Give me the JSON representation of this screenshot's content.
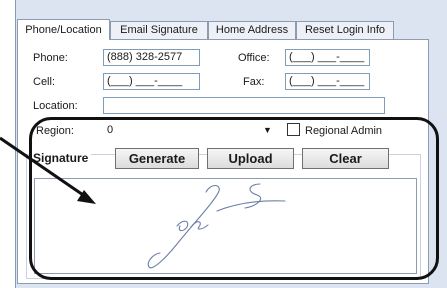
{
  "tabs": [
    {
      "label": "Phone/Location",
      "active": true
    },
    {
      "label": "Email Signature",
      "active": false
    },
    {
      "label": "Home Address",
      "active": false
    },
    {
      "label": "Reset Login Info",
      "active": false
    }
  ],
  "form": {
    "phone_label": "Phone:",
    "phone_value": "(888) 328-2577",
    "office_label": "Office:",
    "office_value": "(___) ___-____",
    "cell_label": "Cell:",
    "cell_value": "(___) ___-____",
    "fax_label": "Fax:",
    "fax_value": "(___) ___-____",
    "location_label": "Location:",
    "location_value": "",
    "region_label": "Region:",
    "region_value": "0",
    "regional_admin_label": "Regional Admin",
    "regional_admin_checked": false
  },
  "signature": {
    "title": "Signature",
    "generate_label": "Generate",
    "upload_label": "Upload",
    "clear_label": "Clear"
  },
  "icons": {
    "dropdown": "chevron-down-icon",
    "annotation_arrow": "arrow-icon"
  },
  "colors": {
    "panel_background": "#dbe4f0",
    "border": "#7f9db9",
    "signature_ink": "#6d7fa8",
    "annotation": "#111111"
  }
}
